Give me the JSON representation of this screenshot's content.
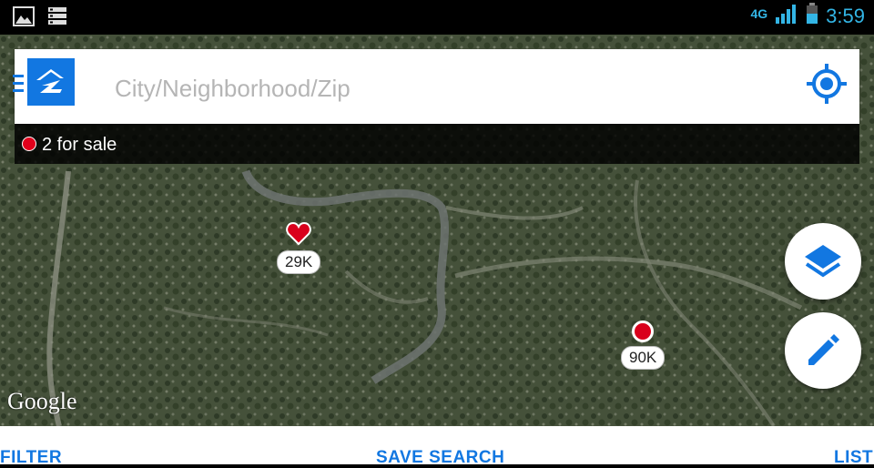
{
  "status_bar": {
    "network": "4G",
    "time": "3:59"
  },
  "search": {
    "placeholder": "City/Neighborhood/Zip",
    "result_count": "2 for sale"
  },
  "map": {
    "markers": [
      {
        "type": "favorite",
        "price": "29K"
      },
      {
        "type": "for-sale",
        "price": "90K"
      }
    ],
    "attribution": "Google"
  },
  "bottom_bar": {
    "filter": "FILTER",
    "save_search": "SAVE SEARCH",
    "list": "LIST"
  },
  "colors": {
    "accent": "#1277e1",
    "marker_red": "#d9001c",
    "status_blue": "#33b5e5"
  }
}
